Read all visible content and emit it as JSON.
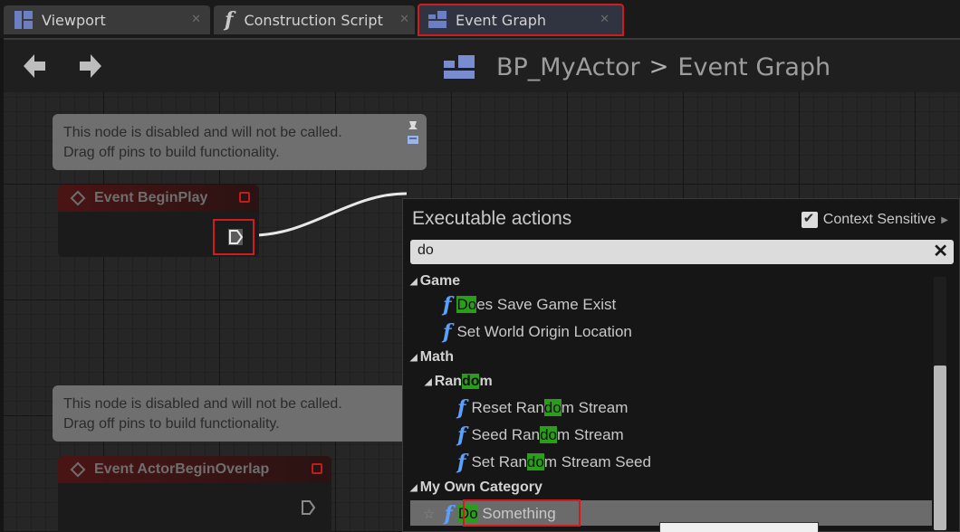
{
  "tabs": [
    {
      "label": "Viewport",
      "icon": "viewport-icon"
    },
    {
      "label": "Construction Script",
      "icon": "function-icon"
    },
    {
      "label": "Event Graph",
      "icon": "event-graph-icon",
      "active": true
    }
  ],
  "toolbar": {
    "back_icon": "back-arrow-icon",
    "forward_icon": "forward-arrow-icon",
    "breadcrumb": {
      "blueprint": "BP_MyActor",
      "separator": ">",
      "graph": "Event Graph"
    }
  },
  "graph": {
    "comments": [
      {
        "line1": "This node is disabled and will not be called.",
        "line2": "Drag off pins to build functionality."
      },
      {
        "line1": "This node is disabled and will not be called.",
        "line2": "Drag off pins to build functionality."
      }
    ],
    "nodes": [
      {
        "title": "Event BeginPlay"
      },
      {
        "title": "Event ActorBeginOverlap"
      }
    ]
  },
  "popup": {
    "title": "Executable actions",
    "context_sensitive_label": "Context Sensitive",
    "context_sensitive_checked": true,
    "search_value": "do",
    "categories": {
      "game": "Game",
      "math": "Math",
      "random": {
        "pre": "Ran",
        "match": "do",
        "post": "m"
      },
      "my_own": "My Own Category"
    },
    "items": {
      "does_save": {
        "pre": "",
        "match": "Do",
        "post": "es Save Game Exist"
      },
      "set_world": {
        "text": "Set World Origin Location"
      },
      "reset_random": {
        "pre": "Reset Ran",
        "match": "do",
        "post": "m Stream"
      },
      "seed_random": {
        "pre": "Seed Ran",
        "match": "do",
        "post": "m Stream"
      },
      "set_random_seed": {
        "pre": "Set Ran",
        "match": "do",
        "post": "m Stream Seed"
      },
      "do_something": {
        "pre": "",
        "match": "Do",
        "post": " Something"
      }
    }
  },
  "colors": {
    "highlight_match": "#2a9d1a",
    "annotation_red": "#d01c1c",
    "function_blue": "#5aa0ff",
    "accent_icon": "#7a8cd0"
  }
}
